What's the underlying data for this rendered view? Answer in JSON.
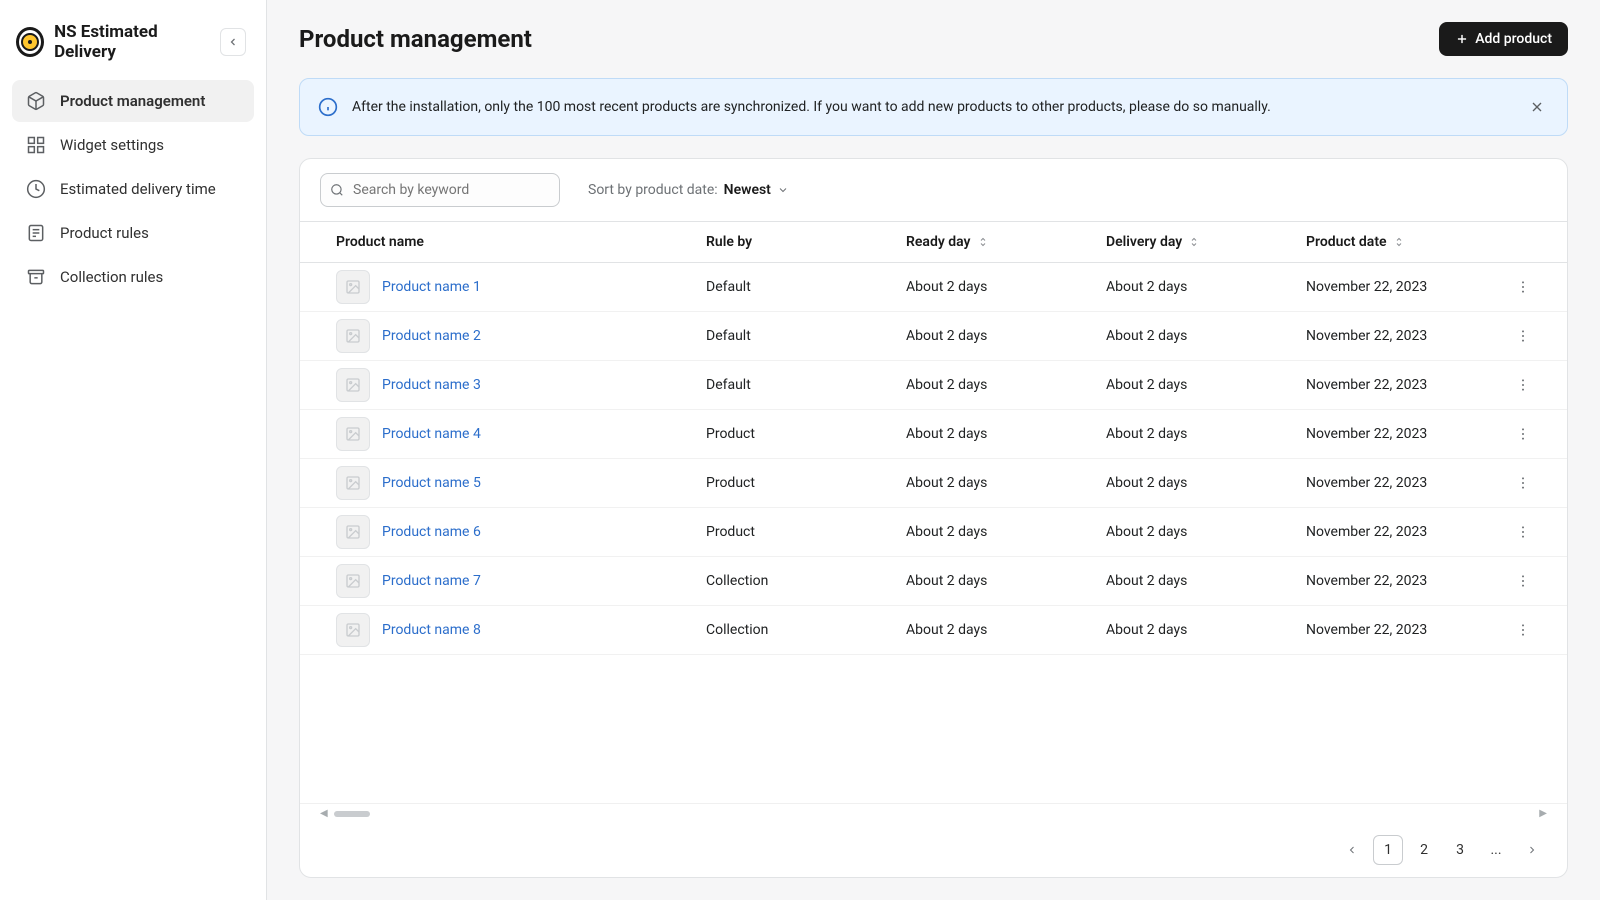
{
  "brand": {
    "name": "NS Estimated Delivery"
  },
  "sidebar": {
    "items": [
      {
        "label": "Product management",
        "active": true
      },
      {
        "label": "Widget settings"
      },
      {
        "label": "Estimated delivery time"
      },
      {
        "label": "Product rules"
      },
      {
        "label": "Collection rules"
      }
    ]
  },
  "page": {
    "title": "Product management",
    "add_button": "Add product"
  },
  "banner": {
    "text": "After the installation, only the 100 most recent products are synchronized. If you want to add new products to other products, please do so manually."
  },
  "toolbar": {
    "search_placeholder": "Search by keyword",
    "sort_label": "Sort by product date:",
    "sort_value": "Newest"
  },
  "columns": {
    "name": "Product name",
    "rule": "Rule by",
    "ready": "Ready day",
    "delivery": "Delivery day",
    "date": "Product date"
  },
  "rows": [
    {
      "name": "Product name 1",
      "rule": "Default",
      "ready": "About 2 days",
      "delivery": "About 2 days",
      "date": "November 22, 2023"
    },
    {
      "name": "Product name 2",
      "rule": "Default",
      "ready": "About 2 days",
      "delivery": "About 2 days",
      "date": "November 22, 2023"
    },
    {
      "name": "Product name 3",
      "rule": "Default",
      "ready": "About 2 days",
      "delivery": "About 2 days",
      "date": "November 22, 2023"
    },
    {
      "name": "Product name 4",
      "rule": "Product",
      "ready": "About 2 days",
      "delivery": "About 2 days",
      "date": "November 22, 2023"
    },
    {
      "name": "Product name 5",
      "rule": "Product",
      "ready": "About 2 days",
      "delivery": "About 2 days",
      "date": "November 22, 2023"
    },
    {
      "name": "Product name 6",
      "rule": "Product",
      "ready": "About 2 days",
      "delivery": "About 2 days",
      "date": "November 22, 2023"
    },
    {
      "name": "Product name 7",
      "rule": "Collection",
      "ready": "About 2 days",
      "delivery": "About 2 days",
      "date": "November 22, 2023"
    },
    {
      "name": "Product name 8",
      "rule": "Collection",
      "ready": "About 2 days",
      "delivery": "About 2 days",
      "date": "November 22, 2023"
    }
  ],
  "pagination": {
    "pages": [
      "1",
      "2",
      "3",
      "..."
    ],
    "active": "1"
  }
}
